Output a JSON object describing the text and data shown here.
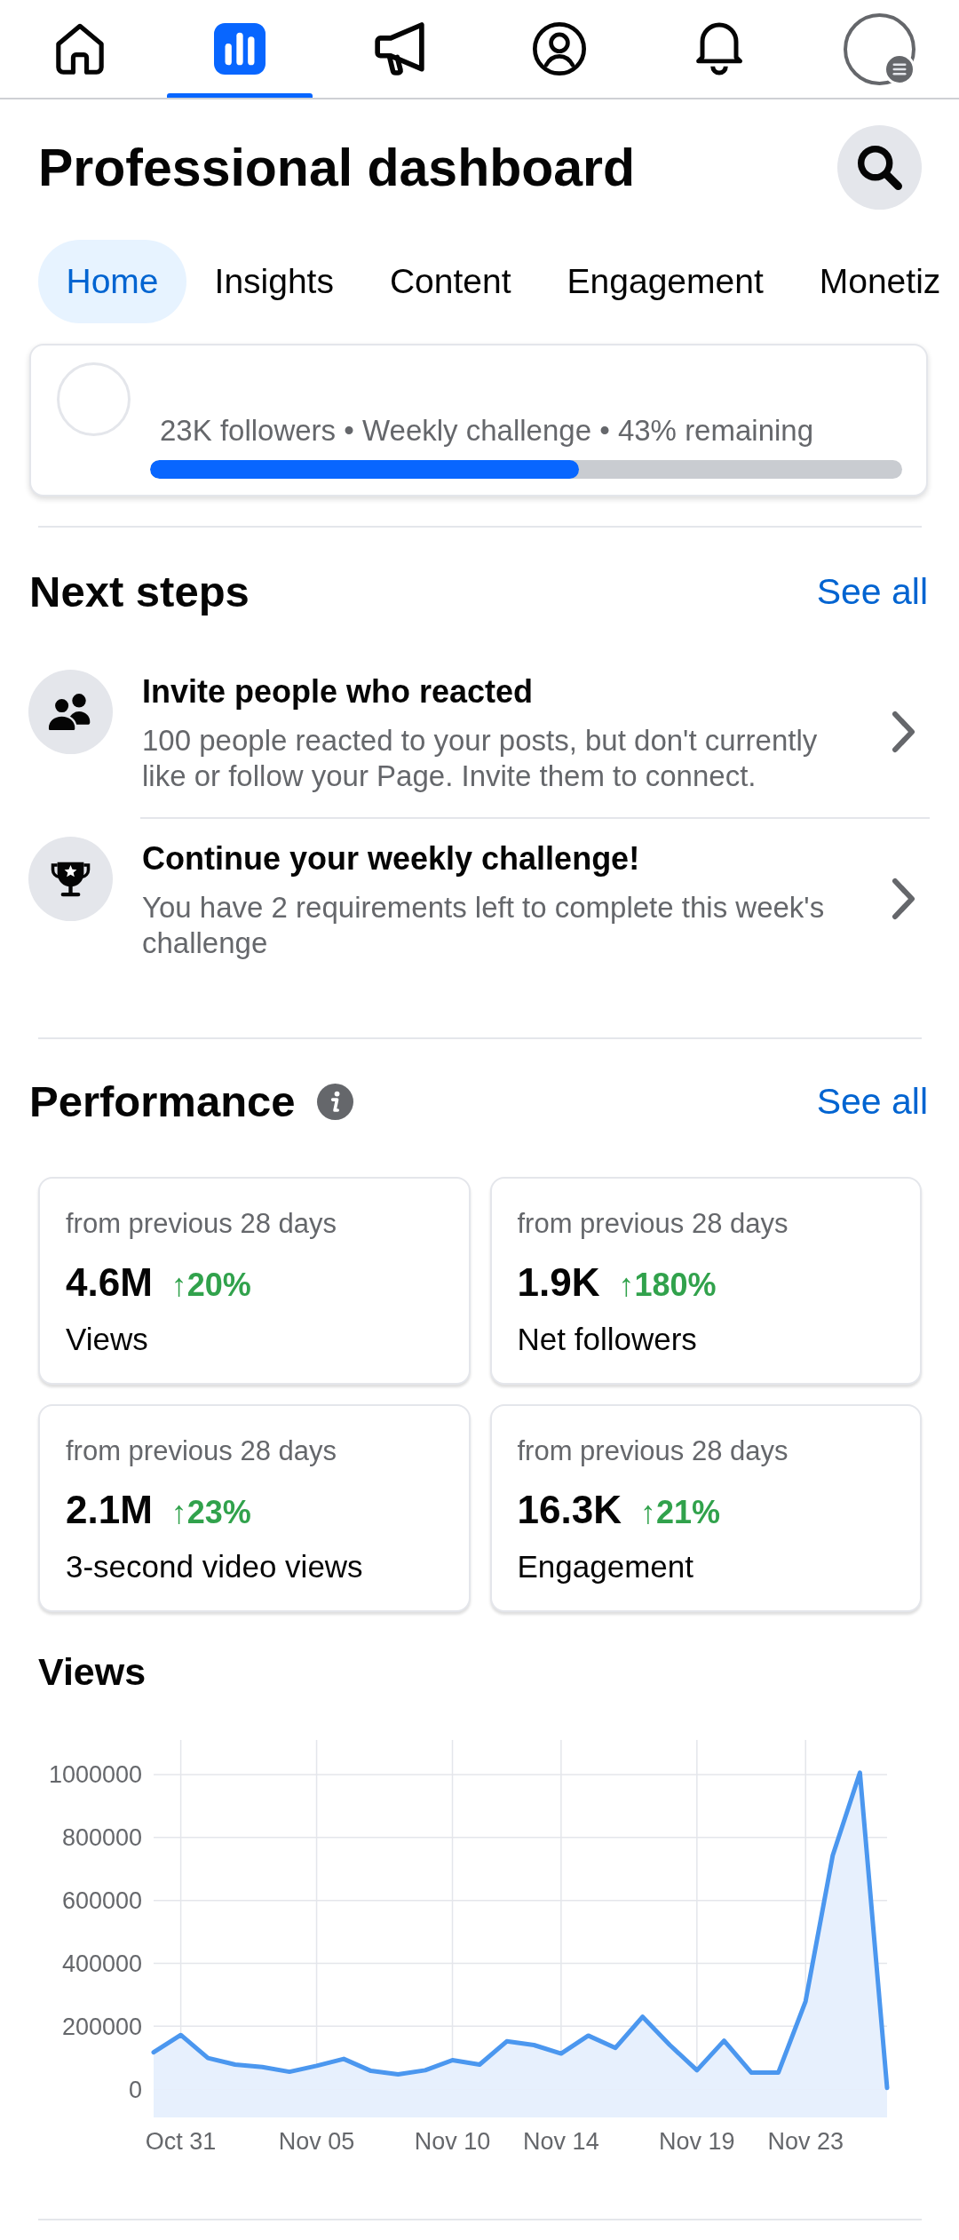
{
  "nav_bar": [
    {
      "kind": "home",
      "selected": false
    },
    {
      "kind": "chart",
      "selected": true
    },
    {
      "kind": "megaphone",
      "selected": false
    },
    {
      "kind": "profile",
      "selected": false
    },
    {
      "kind": "bell",
      "selected": false
    },
    {
      "kind": "menu",
      "selected": false
    }
  ],
  "header": {
    "title": "Professional dashboard"
  },
  "tabs": [
    {
      "label": "Home",
      "selected": true
    },
    {
      "label": "Insights",
      "selected": false
    },
    {
      "label": "Content",
      "selected": false
    },
    {
      "label": "Engagement",
      "selected": false
    },
    {
      "label": "Monetiz",
      "selected": false
    }
  ],
  "follower_card": {
    "summary": "23K followers • Weekly challenge • 43% remaining",
    "progress": {
      "level": 0.57
    }
  },
  "next_steps": {
    "title": "Next steps",
    "see_all": "See all",
    "items": [
      {
        "kind": "people",
        "title": "Invite people who reacted",
        "description": "100 people reacted to your posts, but don't currently like or follow your Page. Invite them to connect."
      },
      {
        "kind": "trophy",
        "title": "Continue your weekly challenge!",
        "description": "You have 2 requirements left to complete this week's challenge"
      }
    ]
  },
  "performance": {
    "title": "Performance",
    "see_all": "See all",
    "metrics": [
      {
        "period": "from previous 28 days",
        "value": "4.6M",
        "change": "↑20%",
        "label": "Views"
      },
      {
        "period": "from previous 28 days",
        "value": "1.9K",
        "change": "↑180%",
        "label": "Net followers"
      },
      {
        "period": "from previous 28 days",
        "value": "2.1M",
        "change": "↑23%",
        "label": "3-second video views"
      },
      {
        "period": "from previous 28 days",
        "value": "16.3K",
        "change": "↑21%",
        "label": "Engagement"
      }
    ]
  },
  "views_chart": {
    "chart_data": {
      "type": "area",
      "title": "Views",
      "grid": true,
      "categories": [
        null,
        "Oct 31",
        null,
        null,
        null,
        null,
        "Nov 05",
        null,
        null,
        null,
        null,
        "Nov 10",
        null,
        null,
        null,
        "Nov 14",
        null,
        null,
        null,
        null,
        "Nov 19",
        null,
        null,
        null,
        "Nov 23",
        null,
        null,
        null
      ],
      "values": [
        117000,
        172000,
        99000,
        78000,
        70000,
        55000,
        74000,
        96000,
        58000,
        47000,
        60000,
        92000,
        78000,
        152000,
        140000,
        113000,
        170000,
        131000,
        230000,
        140000,
        60000,
        154000,
        53000,
        53000,
        279000,
        743000,
        1006000,
        4000
      ],
      "ylim": [
        -90000,
        1110000
      ],
      "yticks": [
        0,
        200000,
        400000,
        600000,
        800000,
        1000000
      ],
      "bands": [
        {
          "axis": "y",
          "from": -90000,
          "to": 0,
          "color": "#e7f0fd"
        }
      ]
    }
  }
}
